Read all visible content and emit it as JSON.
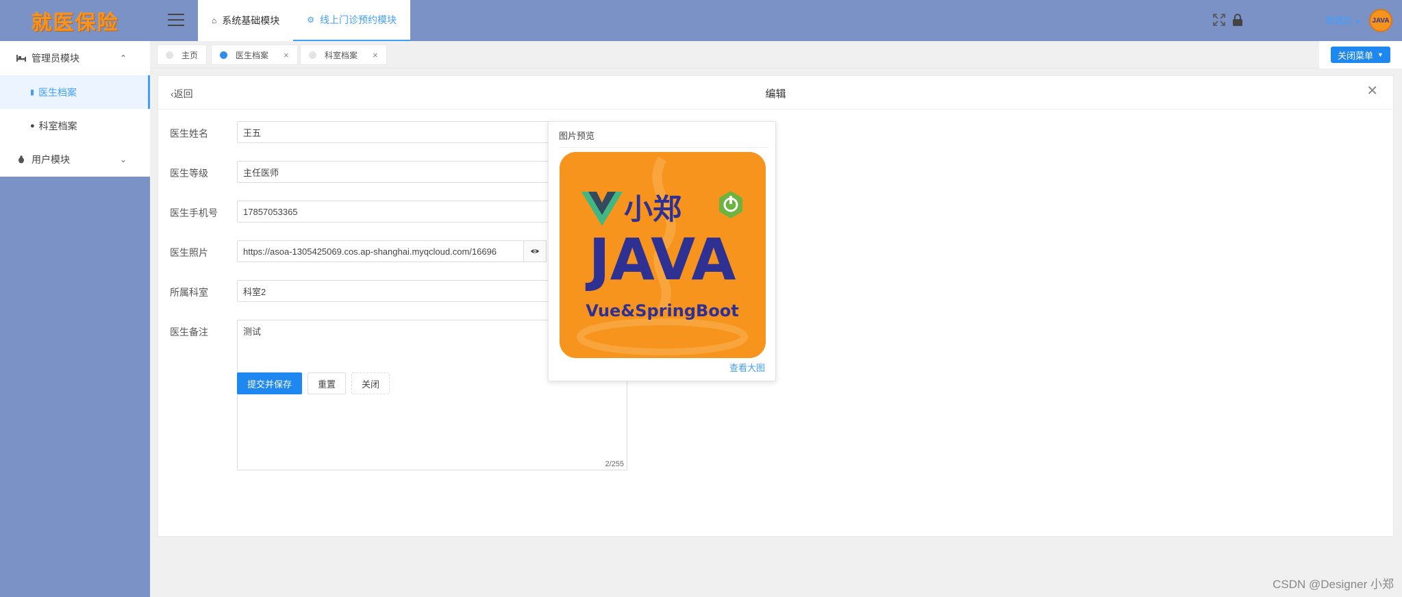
{
  "app": {
    "logo_text": "就医保险"
  },
  "sidebar": {
    "groups": [
      {
        "label": "管理员模块",
        "expanded": true,
        "items": [
          {
            "label": "医生档案",
            "active": true
          },
          {
            "label": "科室档案",
            "active": false
          }
        ]
      },
      {
        "label": "用户模块",
        "expanded": false
      }
    ]
  },
  "header": {
    "tabs": [
      {
        "label": "系统基础模块",
        "icon": "home-icon",
        "active": false
      },
      {
        "label": "线上门诊预约模块",
        "icon": "gear-icon",
        "active": true
      }
    ],
    "user_name": "管理员",
    "avatar_text": "JAVA"
  },
  "tags": [
    {
      "label": "主页",
      "active": false
    },
    {
      "label": "医生档案",
      "active": true,
      "close": "×"
    },
    {
      "label": "科室档案",
      "active": false,
      "close": "×"
    }
  ],
  "close_menu_label": "关闭菜单",
  "card": {
    "back_label": "返回",
    "title": "编辑"
  },
  "form": {
    "name_label": "医生姓名",
    "name_value": "王五",
    "level_label": "医生等级",
    "level_value": "主任医师",
    "phone_label": "医生手机号",
    "phone_value": "17857053365",
    "photo_label": "医生照片",
    "photo_value": "https://asoa-1305425069.cos.ap-shanghai.myqcloud.com/16696",
    "dept_label": "所属科室",
    "dept_value": "科室2",
    "remark_label": "医生备注",
    "remark_value": "测试",
    "remark_counter": "2/255"
  },
  "buttons": {
    "submit": "提交并保存",
    "reset": "重置",
    "close": "关闭"
  },
  "preview": {
    "title": "图片预览",
    "view_large": "查看大图",
    "img_brand": "小郑",
    "img_main": "JAVA",
    "img_sub": "Vue&SpringBoot"
  },
  "watermark": "CSDN @Designer 小郑",
  "colors": {
    "sidebar_bg": "#7b92c7",
    "primary": "#1e87f0",
    "logo": "#f7941d",
    "java_blue": "#2e3192"
  }
}
